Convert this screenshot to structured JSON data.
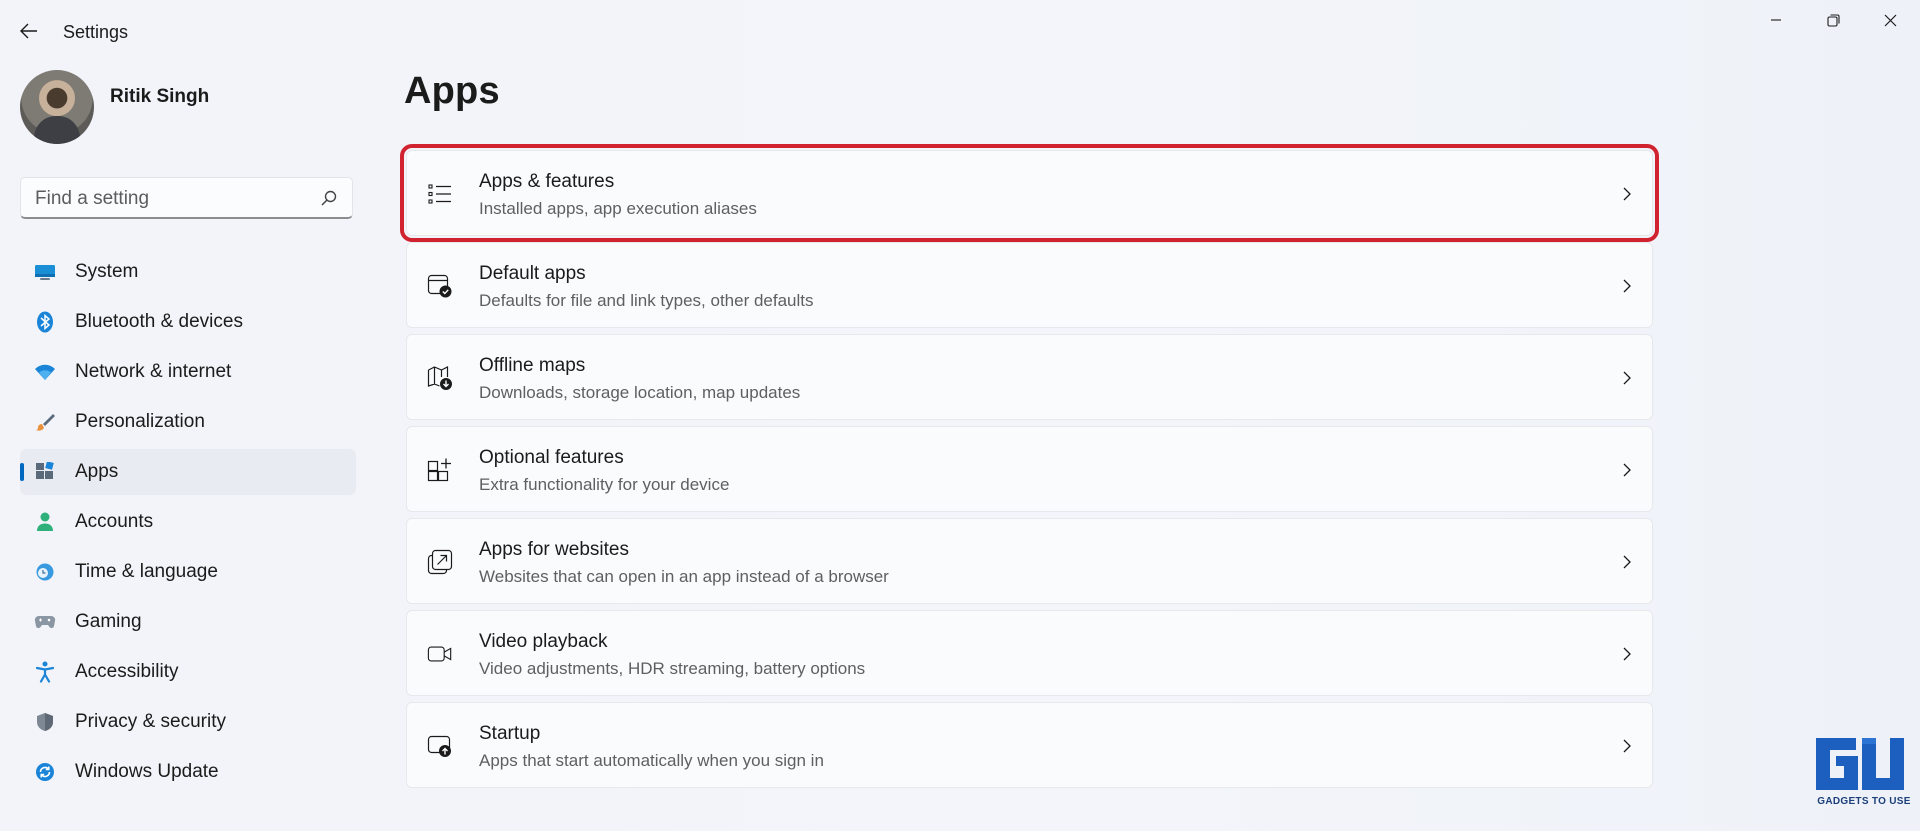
{
  "window": {
    "title": "Settings"
  },
  "user": {
    "name": "Ritik Singh"
  },
  "search": {
    "placeholder": "Find a setting"
  },
  "sidebar": {
    "items": [
      {
        "label": "System",
        "icon": "monitor-icon",
        "active": false
      },
      {
        "label": "Bluetooth & devices",
        "icon": "bluetooth-icon",
        "active": false
      },
      {
        "label": "Network & internet",
        "icon": "wifi-icon",
        "active": false
      },
      {
        "label": "Personalization",
        "icon": "brush-icon",
        "active": false
      },
      {
        "label": "Apps",
        "icon": "apps-icon",
        "active": true
      },
      {
        "label": "Accounts",
        "icon": "person-icon",
        "active": false
      },
      {
        "label": "Time & language",
        "icon": "globe-clock-icon",
        "active": false
      },
      {
        "label": "Gaming",
        "icon": "gamepad-icon",
        "active": false
      },
      {
        "label": "Accessibility",
        "icon": "accessibility-icon",
        "active": false
      },
      {
        "label": "Privacy & security",
        "icon": "shield-icon",
        "active": false
      },
      {
        "label": "Windows Update",
        "icon": "update-icon",
        "active": false
      }
    ]
  },
  "main": {
    "title": "Apps",
    "cards": [
      {
        "title": "Apps & features",
        "subtitle": "Installed apps, app execution aliases",
        "icon": "list-icon",
        "highlighted": true
      },
      {
        "title": "Default apps",
        "subtitle": "Defaults for file and link types, other defaults",
        "icon": "default-apps-icon",
        "highlighted": false
      },
      {
        "title": "Offline maps",
        "subtitle": "Downloads, storage location, map updates",
        "icon": "map-download-icon",
        "highlighted": false
      },
      {
        "title": "Optional features",
        "subtitle": "Extra functionality for your device",
        "icon": "grid-add-icon",
        "highlighted": false
      },
      {
        "title": "Apps for websites",
        "subtitle": "Websites that can open in an app instead of a browser",
        "icon": "open-in-app-icon",
        "highlighted": false
      },
      {
        "title": "Video playback",
        "subtitle": "Video adjustments, HDR streaming, battery options",
        "icon": "video-camera-icon",
        "highlighted": false
      },
      {
        "title": "Startup",
        "subtitle": "Apps that start automatically when you sign in",
        "icon": "startup-icon",
        "highlighted": false
      }
    ]
  },
  "watermark": {
    "text": "GADGETS TO USE"
  },
  "colors": {
    "accent": "#0067c0",
    "highlight_border": "#d1222f",
    "watermark": "#1c5fbf"
  }
}
